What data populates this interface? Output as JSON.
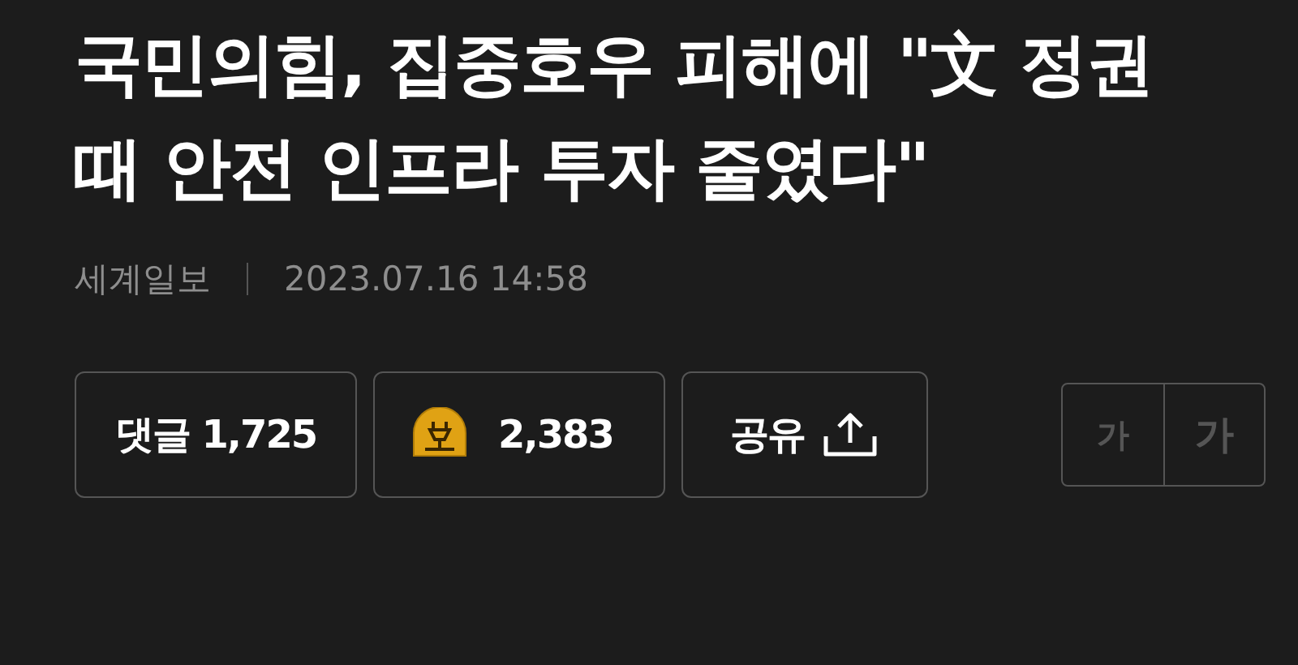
{
  "headline": "국민의힘, 집중호우 피해에 \"文 정권 때 안전 인프라 투자 줄였다\"",
  "meta": {
    "source": "세계일보",
    "datetime": "2023.07.16 14:58"
  },
  "actions": [
    {
      "kind": "comments",
      "label": "댓글 1,725"
    },
    {
      "kind": "reaction",
      "label": "2,383"
    },
    {
      "kind": "share",
      "label": "공유"
    }
  ],
  "font_size_buttons": [
    {
      "label": "가"
    },
    {
      "label": "가"
    }
  ]
}
